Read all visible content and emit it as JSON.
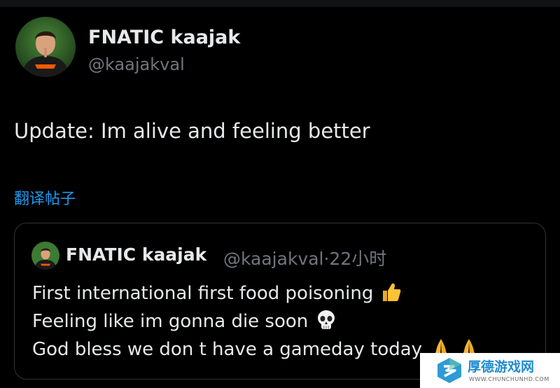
{
  "tweet": {
    "author": {
      "display_name": "FNATIC kaajak",
      "handle": "@kaajakval"
    },
    "text": "Update: Im alive and feeling better",
    "translate_label": "翻译帖子"
  },
  "quoted_tweet": {
    "author": {
      "display_name": "FNATIC kaajak",
      "handle": "@kaajakval",
      "time": "22小时"
    },
    "meta": "@kaajakval·22小时",
    "lines": [
      "First international first food poisoning",
      "Feeling like im gonna die soon",
      "God bless we don t have a gameday today"
    ],
    "emojis": [
      "thumbs-up-icon",
      "skull-icon",
      "praying-hands-icon"
    ]
  },
  "watermark": {
    "name": "厚德游戏网",
    "url": "WWW.CHUNCHUNHD.COM"
  },
  "colors": {
    "background": "#000000",
    "text": "#e7e9ea",
    "muted": "#71767b",
    "link": "#1d9bf0",
    "border": "#2f3336",
    "brand_orange": "#ff5a00"
  }
}
